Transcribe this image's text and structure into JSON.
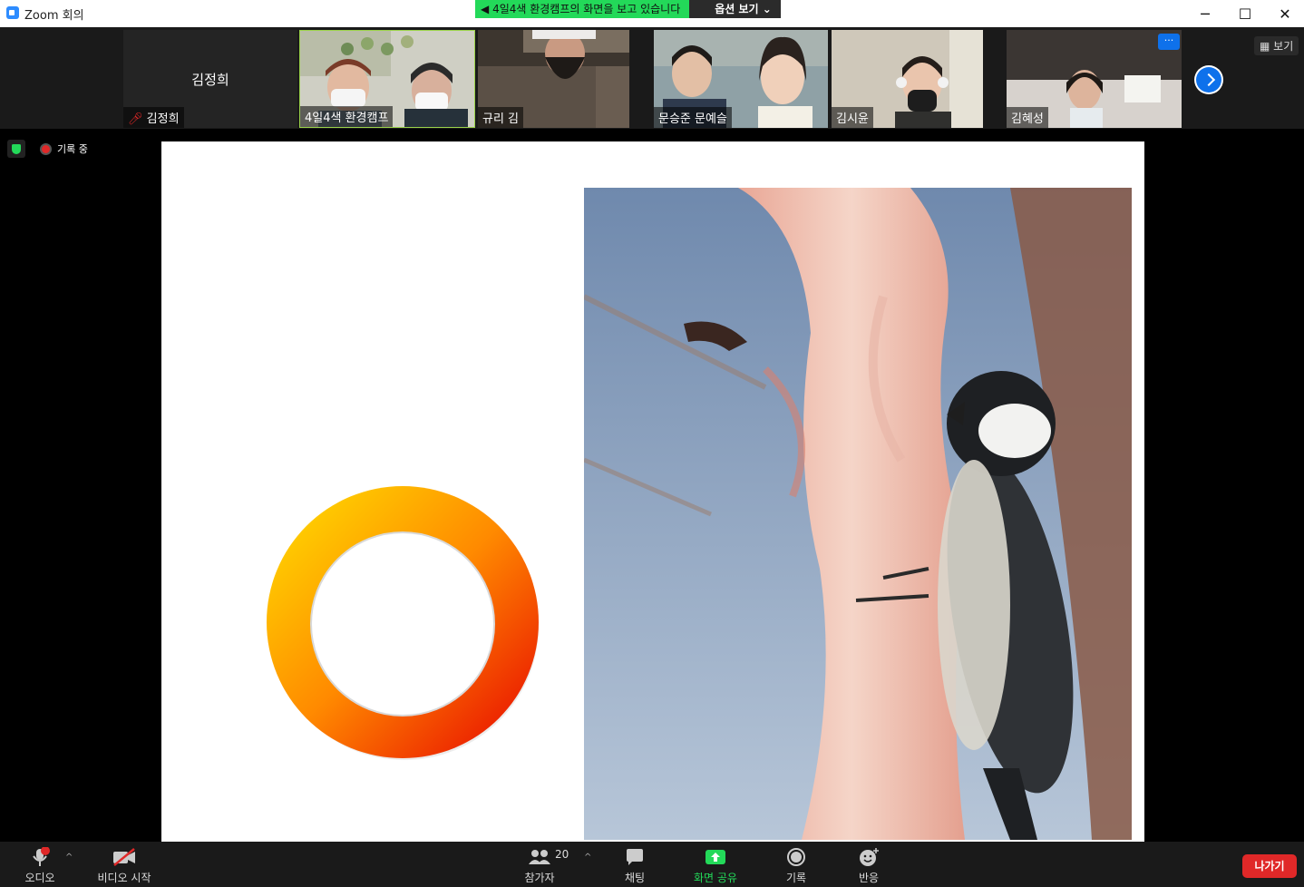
{
  "window": {
    "title": "Zoom 회의",
    "minimize": "─",
    "maximize": "☐",
    "close": "✕"
  },
  "share_banner": {
    "message": "4일4색 환경캠프의 화면을 보고 있습니다",
    "options_label": "옵션 보기"
  },
  "participant_strip": {
    "view_label": "보기",
    "more_label": "···",
    "tiles": [
      {
        "name": "김정희",
        "display": "김정희",
        "muted": true
      },
      {
        "name": "4일4색 환경캠프"
      },
      {
        "name": "규리 김"
      },
      {
        "name": "문승준 문예슬"
      },
      {
        "name": "김시윤"
      },
      {
        "name": "김혜성"
      }
    ]
  },
  "status": {
    "recording_label": "기록 중"
  },
  "toolbar": {
    "audio_label": "오디오",
    "video_label": "비디오 시작",
    "participants_label": "참가자",
    "participants_count": "20",
    "chat_label": "채팅",
    "share_label": "화면 공유",
    "record_label": "기록",
    "reactions_label": "반응",
    "leave_label": "나가기",
    "caret": "^"
  },
  "colors": {
    "accent": "#0E71EB",
    "share_green": "#23D959",
    "leave_red": "#E02828",
    "bar_bg": "#1A1A1A"
  }
}
